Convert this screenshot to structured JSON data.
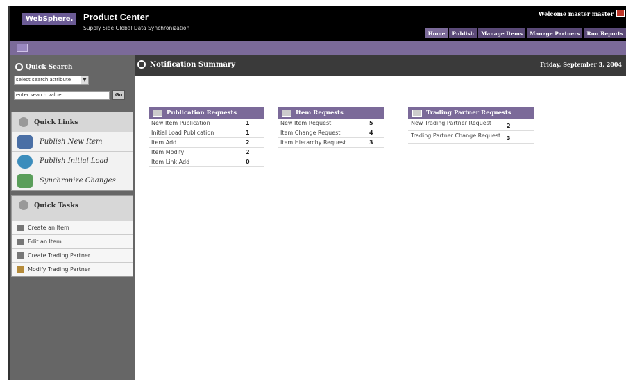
{
  "header": {
    "brand": "WebSphere.",
    "product": "Product Center",
    "tagline": "Supply Side Global Data Synchronization",
    "welcome": "Welcome master master",
    "tabs": [
      "Home",
      "Publish",
      "Manage Items",
      "Manage Partners",
      "Run Reports"
    ]
  },
  "sidebar": {
    "quick_search": {
      "title": "Quick Search",
      "select_value": "select search attribute",
      "input_value": "enter search value",
      "go_label": "Go"
    },
    "quick_links": {
      "title": "Quick Links",
      "items": [
        {
          "label": "Publish New Item",
          "icon": "publish-new-item-icon"
        },
        {
          "label": "Publish Initial Load",
          "icon": "publish-initial-load-icon"
        },
        {
          "label": "Synchronize Changes",
          "icon": "synchronize-changes-icon"
        }
      ]
    },
    "quick_tasks": {
      "title": "Quick Tasks",
      "items": [
        {
          "label": "Create an Item"
        },
        {
          "label": "Edit an Item"
        },
        {
          "label": "Create Trading Partner"
        },
        {
          "label": "Modify Trading Partner"
        }
      ]
    }
  },
  "main": {
    "title": "Notification Summary",
    "date": "Friday, September 3, 2004",
    "boxes": [
      {
        "title": "Publication Requests",
        "rows": [
          {
            "label": "New Item Publication",
            "count": "1"
          },
          {
            "label": "Initial Load Publication",
            "count": "1"
          },
          {
            "label": "Item Add",
            "count": "2"
          },
          {
            "label": "Item Modify",
            "count": "2"
          },
          {
            "label": "Item Link Add",
            "count": "0"
          }
        ]
      },
      {
        "title": "Item Requests",
        "rows": [
          {
            "label": "New Item Request",
            "count": "5"
          },
          {
            "label": "Item Change Request",
            "count": "4"
          },
          {
            "label": "Item Hierarchy Request",
            "count": "3"
          }
        ]
      },
      {
        "title": "Trading Partner Requests",
        "rows": [
          {
            "label": "New Trading Partner Request",
            "count": "2"
          },
          {
            "label": "Trading Partner Change Request",
            "count": "3"
          }
        ]
      }
    ]
  },
  "colors": {
    "accent": "#7b6a99",
    "header_bg": "#000000",
    "sidebar_bg": "#666666"
  }
}
